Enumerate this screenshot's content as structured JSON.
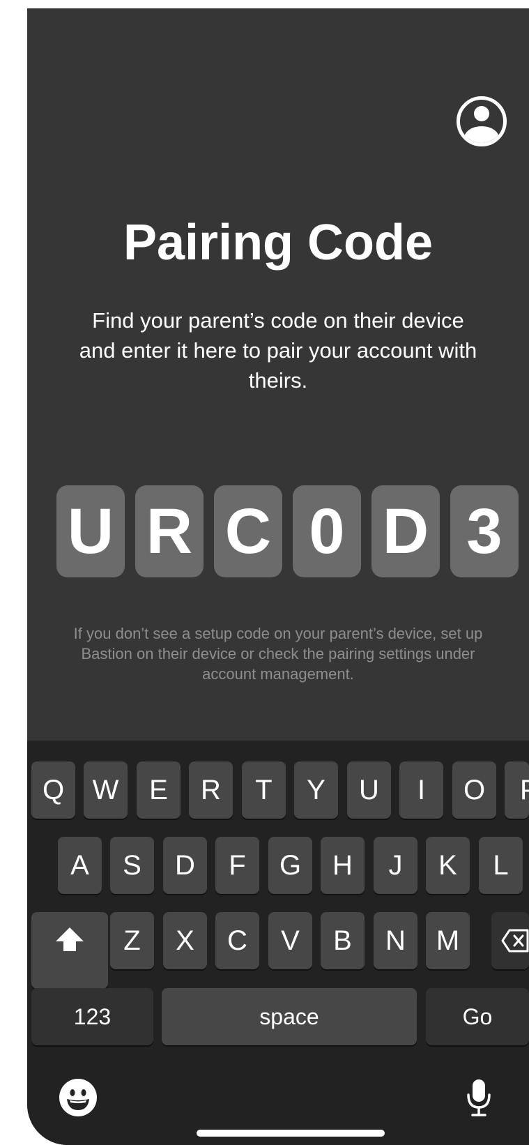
{
  "screen": {
    "title": "Pairing Code",
    "subtitle": "Find your parent’s code on their device and enter it here to pair your account with theirs.",
    "code": [
      "U",
      "R",
      "C",
      "0",
      "D",
      "3"
    ],
    "help_text": "If you don’t see a setup code on your parent’s device, set up Bastion on their device or check the pairing settings under account management."
  },
  "keyboard": {
    "row1": [
      "Q",
      "W",
      "E",
      "R",
      "T",
      "Y",
      "U",
      "I",
      "O",
      "P"
    ],
    "row2": [
      "A",
      "S",
      "D",
      "F",
      "G",
      "H",
      "J",
      "K",
      "L"
    ],
    "row3": [
      "Z",
      "X",
      "C",
      "V",
      "B",
      "N",
      "M"
    ],
    "numbers_label": "123",
    "space_label": "space",
    "go_label": "Go"
  },
  "icons": {
    "profile": "person-circle-icon",
    "shift": "shift-arrow-icon",
    "delete": "backspace-icon",
    "emoji": "emoji-icon",
    "microphone": "microphone-icon"
  }
}
